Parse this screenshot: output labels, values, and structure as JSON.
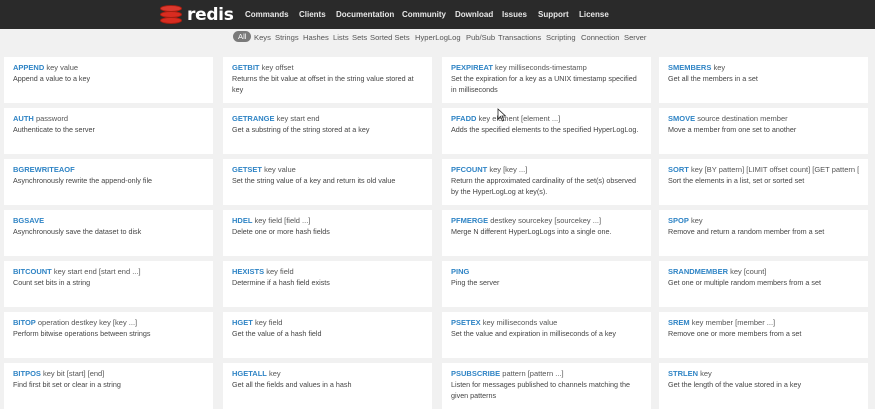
{
  "brand": {
    "name": "redis"
  },
  "nav": [
    "Commands",
    "Clients",
    "Documentation",
    "Community",
    "Download",
    "Issues",
    "Support",
    "License"
  ],
  "filters": [
    "All",
    "Keys",
    "Strings",
    "Hashes",
    "Lists",
    "Sets",
    "Sorted Sets",
    "HyperLogLog",
    "Pub/Sub",
    "Transactions",
    "Scripting",
    "Connection",
    "Server"
  ],
  "active_filter": "All",
  "columns": [
    [
      {
        "name": "APPEND",
        "args": "key value",
        "desc": "Append a value to a key"
      },
      {
        "name": "AUTH",
        "args": "password",
        "desc": "Authenticate to the server"
      },
      {
        "name": "BGREWRITEAOF",
        "args": "",
        "desc": "Asynchronously rewrite the append-only file"
      },
      {
        "name": "BGSAVE",
        "args": "",
        "desc": "Asynchronously save the dataset to disk"
      },
      {
        "name": "BITCOUNT",
        "args": "key start end [start end ...]",
        "desc": "Count set bits in a string"
      },
      {
        "name": "BITOP",
        "args": "operation destkey key [key ...]",
        "desc": "Perform bitwise operations between strings"
      },
      {
        "name": "BITPOS",
        "args": "key bit [start] [end]",
        "desc": "Find first bit set or clear in a string"
      }
    ],
    [
      {
        "name": "GETBIT",
        "args": "key offset",
        "desc": "Returns the bit value at offset in the string value stored at key"
      },
      {
        "name": "GETRANGE",
        "args": "key start end",
        "desc": "Get a substring of the string stored at a key"
      },
      {
        "name": "GETSET",
        "args": "key value",
        "desc": "Set the string value of a key and return its old value"
      },
      {
        "name": "HDEL",
        "args": "key field [field ...]",
        "desc": "Delete one or more hash fields"
      },
      {
        "name": "HEXISTS",
        "args": "key field",
        "desc": "Determine if a hash field exists"
      },
      {
        "name": "HGET",
        "args": "key field",
        "desc": "Get the value of a hash field"
      },
      {
        "name": "HGETALL",
        "args": "key",
        "desc": "Get all the fields and values in a hash"
      }
    ],
    [
      {
        "name": "PEXPIREAT",
        "args": "key milliseconds-timestamp",
        "desc": "Set the expiration for a key as a UNIX timestamp specified in milliseconds"
      },
      {
        "name": "PFADD",
        "args": "key element [element ...]",
        "desc": "Adds the specified elements to the specified HyperLogLog."
      },
      {
        "name": "PFCOUNT",
        "args": "key [key ...]",
        "desc": "Return the approximated cardinality of the set(s) observed by the HyperLogLog at key(s)."
      },
      {
        "name": "PFMERGE",
        "args": "destkey sourcekey [sourcekey ...]",
        "desc": "Merge N different HyperLogLogs into a single one."
      },
      {
        "name": "PING",
        "args": "",
        "desc": "Ping the server"
      },
      {
        "name": "PSETEX",
        "args": "key milliseconds value",
        "desc": "Set the value and expiration in milliseconds of a key"
      },
      {
        "name": "PSUBSCRIBE",
        "args": "pattern [pattern ...]",
        "desc": "Listen for messages published to channels matching the given patterns"
      }
    ],
    [
      {
        "name": "SMEMBERS",
        "args": "key",
        "desc": "Get all the members in a set"
      },
      {
        "name": "SMOVE",
        "args": "source destination member",
        "desc": "Move a member from one set to another"
      },
      {
        "name": "SORT",
        "args": "key [BY pattern] [LIMIT offset count] [GET pattern [...",
        "desc": "Sort the elements in a list, set or sorted set"
      },
      {
        "name": "SPOP",
        "args": "key",
        "desc": "Remove and return a random member from a set"
      },
      {
        "name": "SRANDMEMBER",
        "args": "key [count]",
        "desc": "Get one or multiple random members from a set"
      },
      {
        "name": "SREM",
        "args": "key member [member ...]",
        "desc": "Remove one or more members from a set"
      },
      {
        "name": "STRLEN",
        "args": "key",
        "desc": "Get the length of the value stored in a key"
      }
    ]
  ]
}
